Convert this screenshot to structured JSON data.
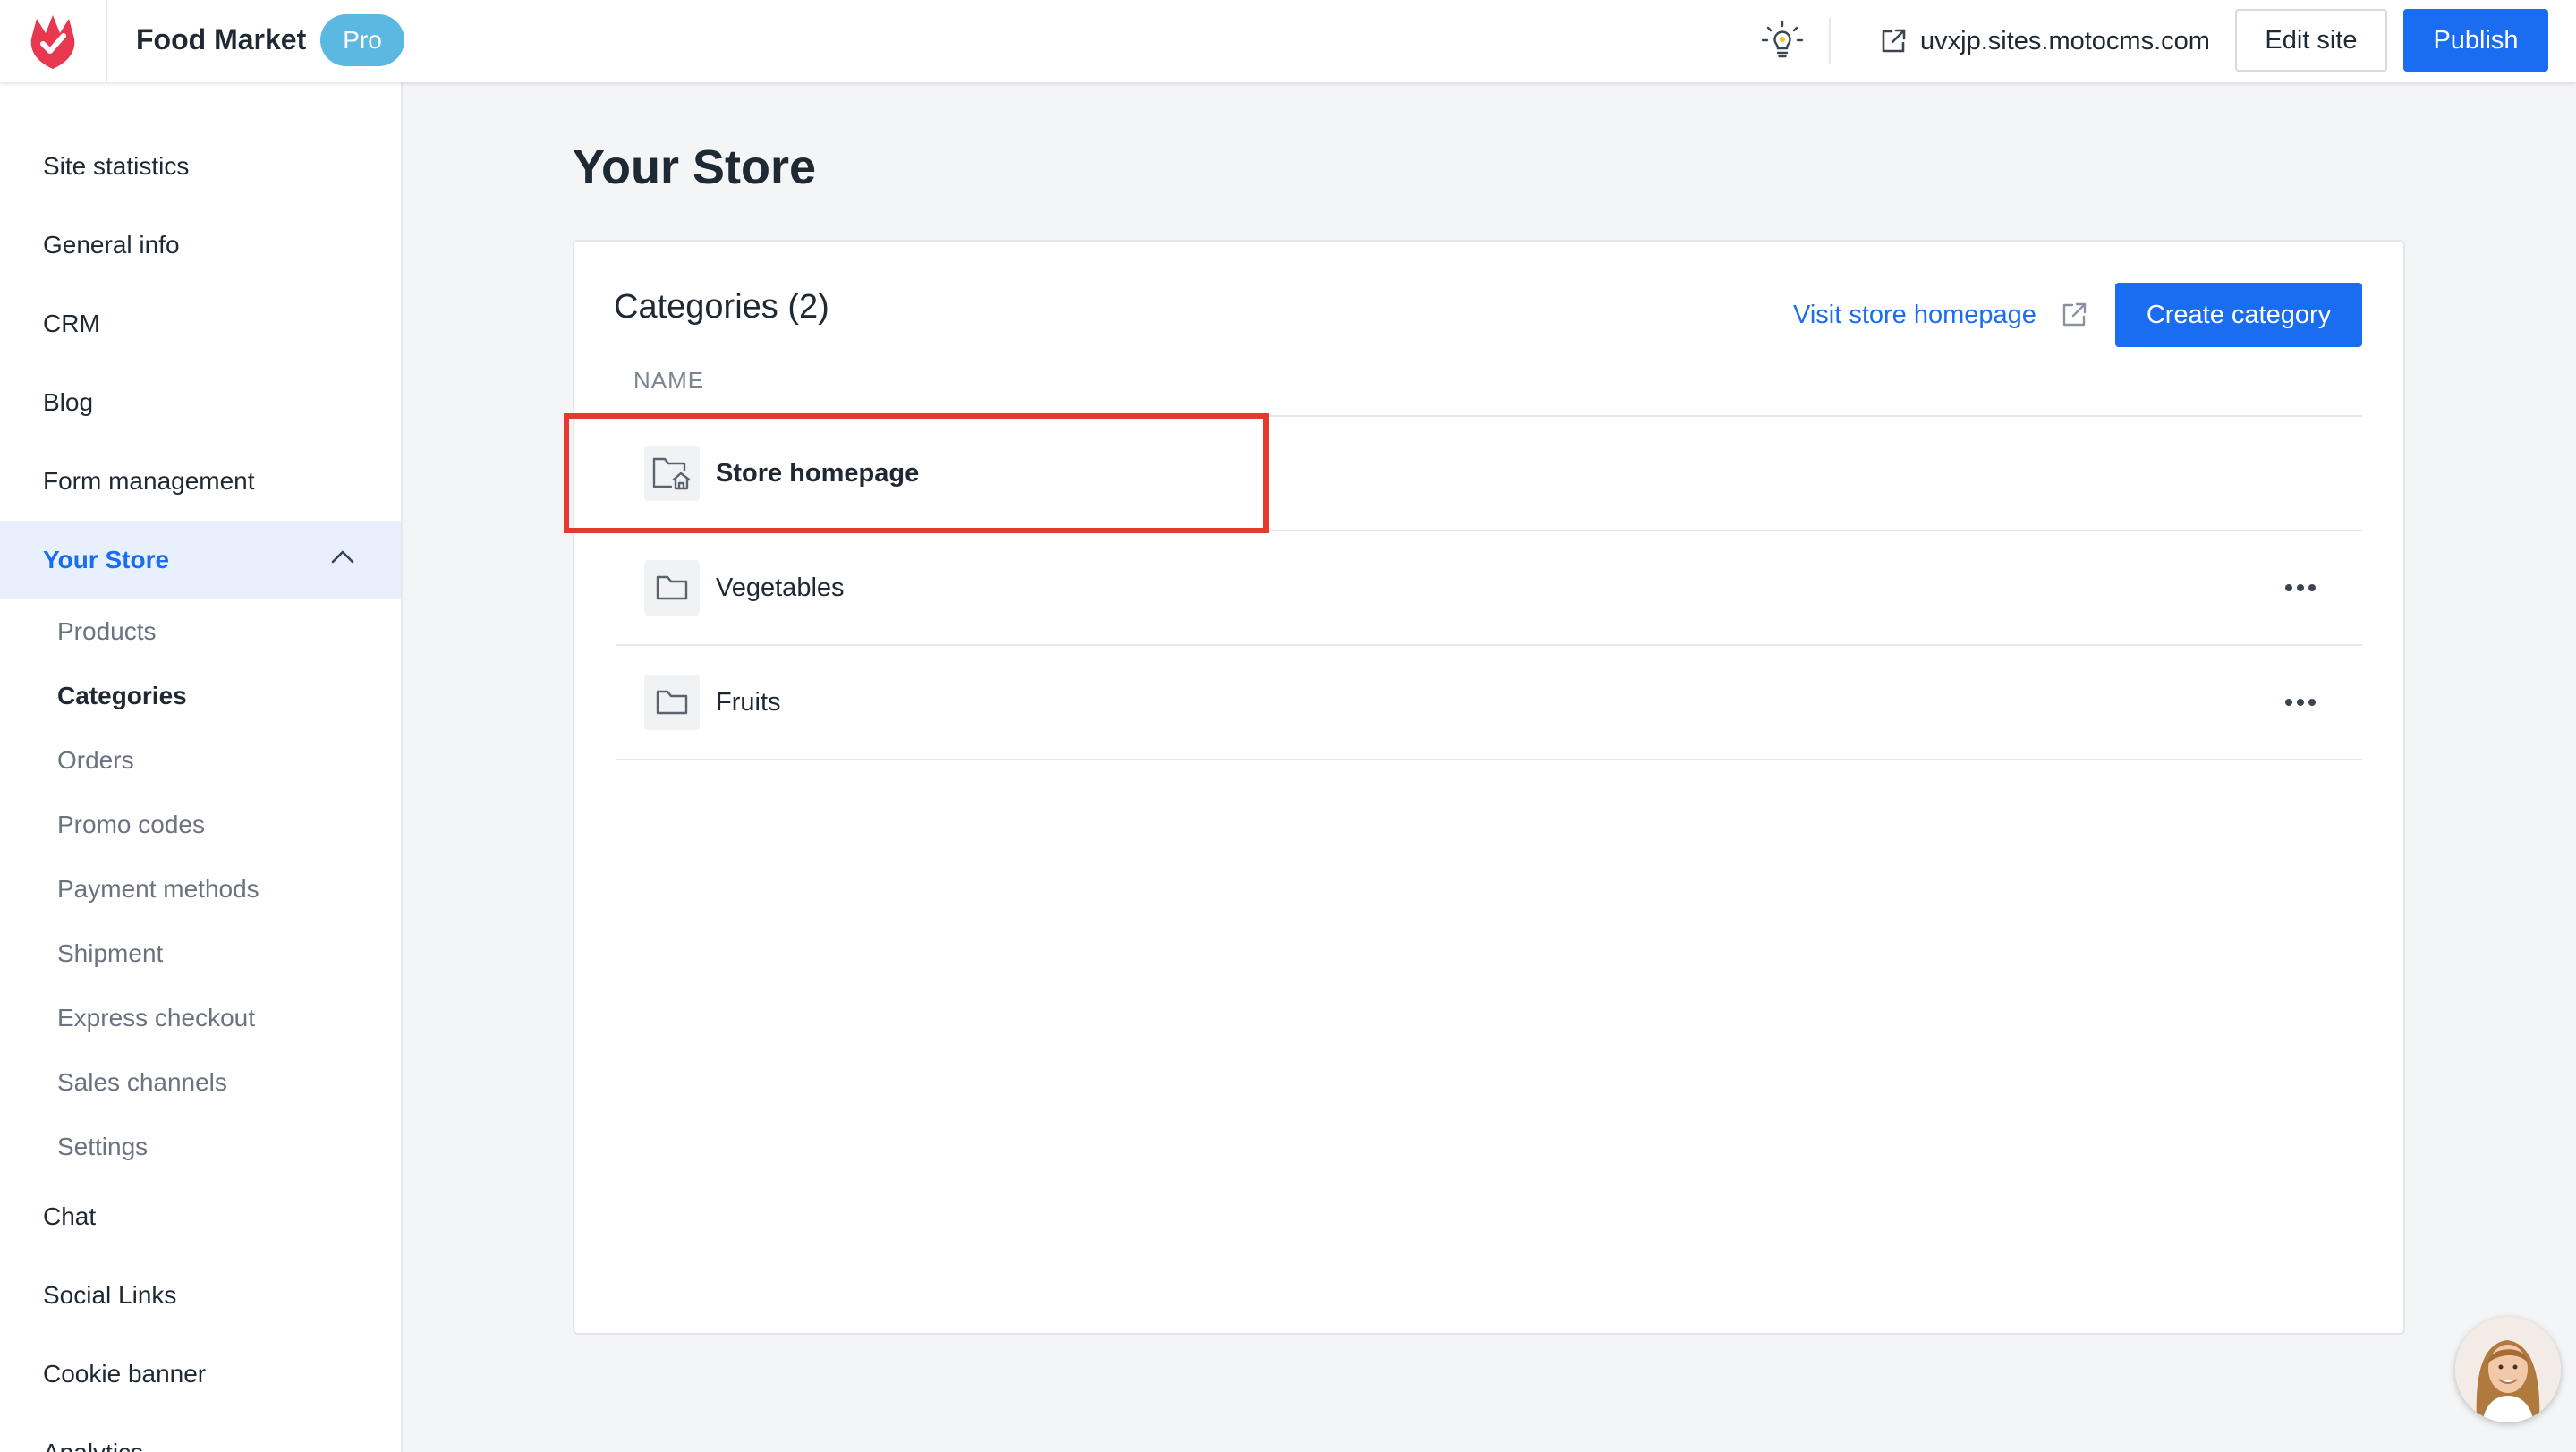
{
  "header": {
    "app_title": "Food Market",
    "plan_badge": "Pro",
    "site_url": "uvxjp.sites.motocms.com",
    "edit_label": "Edit site",
    "publish_label": "Publish",
    "icons": [
      "brand-logo-icon",
      "lightbulb-icon",
      "external-link-icon"
    ]
  },
  "sidebar": {
    "items": [
      {
        "label": "Site statistics"
      },
      {
        "label": "General info"
      },
      {
        "label": "CRM"
      },
      {
        "label": "Blog"
      },
      {
        "label": "Form management"
      },
      {
        "label": "Your Store",
        "active": true,
        "expanded": true
      }
    ],
    "store_sub_items": [
      {
        "label": "Products"
      },
      {
        "label": "Categories",
        "current": true
      },
      {
        "label": "Orders"
      },
      {
        "label": "Promo codes"
      },
      {
        "label": "Payment methods"
      },
      {
        "label": "Shipment"
      },
      {
        "label": "Express checkout"
      },
      {
        "label": "Sales channels"
      },
      {
        "label": "Settings"
      }
    ],
    "bottom_items": [
      {
        "label": "Chat"
      },
      {
        "label": "Social Links"
      },
      {
        "label": "Cookie banner"
      },
      {
        "label": "Analytics"
      }
    ]
  },
  "main": {
    "page_title": "Your Store",
    "card_title": "Categories (2)",
    "visit_link": "Visit store homepage",
    "create_label": "Create category",
    "column_header": "NAME",
    "rows": [
      {
        "label": "Store homepage",
        "icon": "folder-home-icon",
        "bold": true,
        "has_menu": false
      },
      {
        "label": "Vegetables",
        "icon": "folder-icon",
        "bold": false,
        "has_menu": true
      },
      {
        "label": "Fruits",
        "icon": "folder-icon",
        "bold": false,
        "has_menu": true
      }
    ]
  },
  "colors": {
    "accent": "#1a6cf0",
    "badge": "#5bb8e0",
    "highlight": "#e23b2e",
    "active_bg": "#e8f0fe"
  }
}
